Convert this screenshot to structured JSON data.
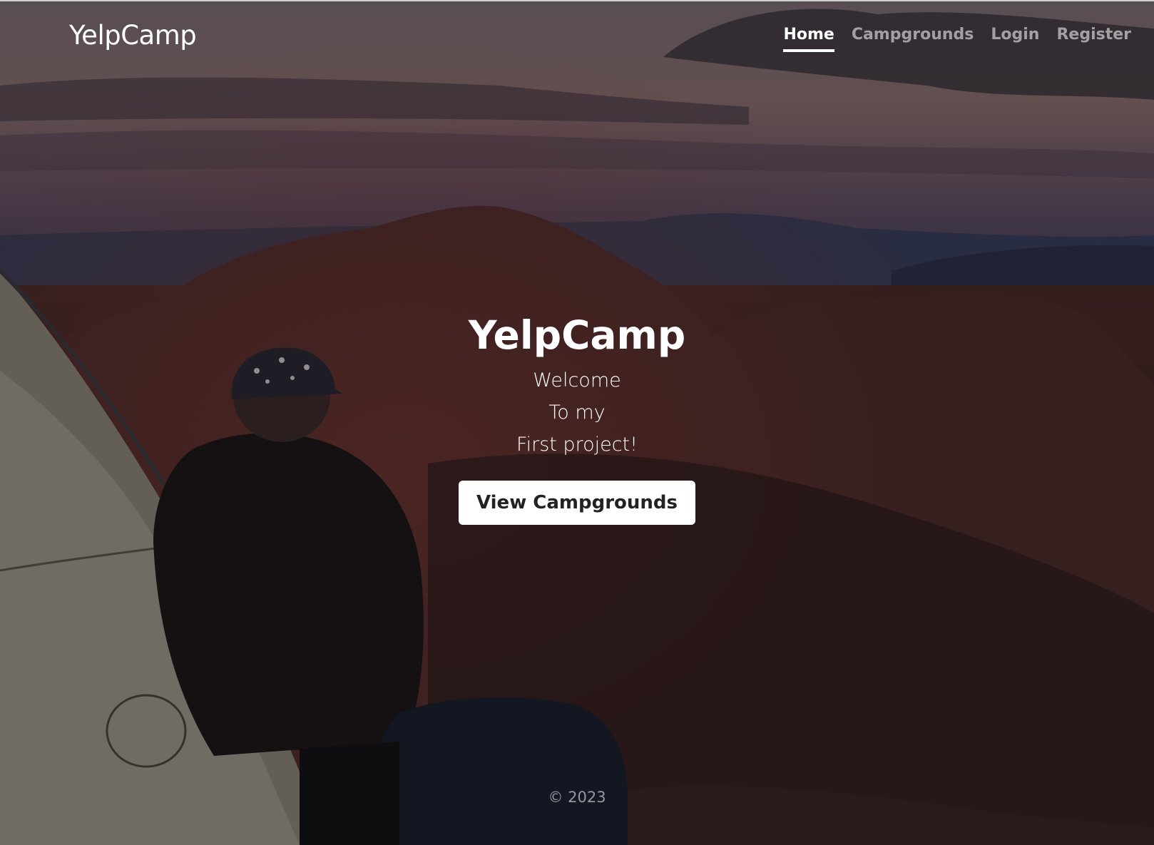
{
  "brand": "YelpCamp",
  "nav": {
    "items": [
      {
        "label": "Home",
        "active": true
      },
      {
        "label": "Campgrounds",
        "active": false
      },
      {
        "label": "Login",
        "active": false
      },
      {
        "label": "Register",
        "active": false
      }
    ]
  },
  "hero": {
    "title": "YelpCamp",
    "lines": [
      "Welcome",
      "To my",
      "First project!"
    ],
    "cta_label": "View Campgrounds"
  },
  "footer": {
    "copyright": "© 2023"
  },
  "colors": {
    "text": "#ffffff",
    "muted_nav": "#9a9a9a",
    "button_bg": "#ffffff",
    "button_text": "#222222"
  }
}
